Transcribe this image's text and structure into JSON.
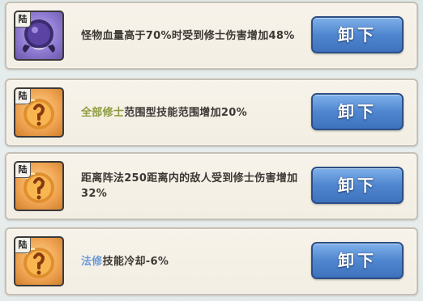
{
  "cards": [
    {
      "tag": "陆",
      "icon": "purple-monster-orb-icon",
      "desc_pre": "",
      "desc_hl": "",
      "desc_post": "怪物血量高于70%时受到修士伤害增加48%",
      "button": "卸下"
    },
    {
      "tag": "陆",
      "icon": "orange-fire-orb-icon",
      "desc_pre": "",
      "desc_hl": "全部修士",
      "desc_post": "范围型技能范围增加20%",
      "button": "卸下"
    },
    {
      "tag": "陆",
      "icon": "orange-fire-orb-icon",
      "desc_pre": "",
      "desc_hl": "",
      "desc_post": "距离阵法250距离内的敌人受到修士伤害增加32%",
      "button": "卸下"
    },
    {
      "tag": "陆",
      "icon": "orange-fire-orb-icon",
      "desc_pre": "",
      "desc_hl": "法修",
      "desc_post": "技能冷却-6%",
      "button": "卸下"
    }
  ],
  "colors": {
    "highlight_green": "#8d9a3c",
    "highlight_blue": "#6a9ad8",
    "button_blue": "#4f86cf"
  }
}
